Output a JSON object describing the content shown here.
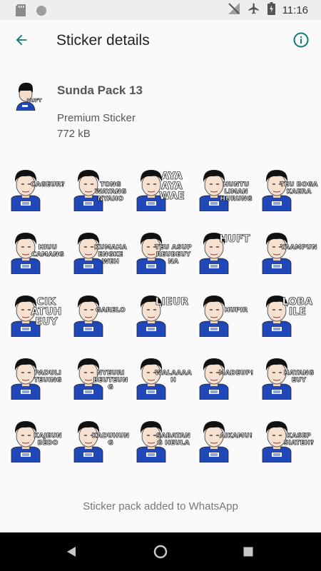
{
  "status_bar": {
    "time": "11:16",
    "icons": [
      "sd-card-icon",
      "circle-icon",
      "no-signal-icon",
      "airplane-icon",
      "battery-charging-icon"
    ]
  },
  "app_bar": {
    "title": "Sticker details",
    "back_icon": "arrow-left-icon",
    "info_icon": "info-circle-icon",
    "accent_color": "#0f7a73"
  },
  "pack": {
    "name": "Sunda Pack 13",
    "publisher": "Premium Sticker",
    "size": "772 kB",
    "icon_caption": "HUFT"
  },
  "stickers": [
    {
      "label": "CAGEUR?",
      "big": false
    },
    {
      "label": "TONG WAYANG NYAHO",
      "big": false
    },
    {
      "label": "AYA AYA WAE",
      "big": true
    },
    {
      "label": "HUNTU LIMAN HURUNG",
      "big": false
    },
    {
      "label": "TEU BOGA KAERA",
      "big": false
    },
    {
      "label": "HIUU CAMANG",
      "big": false
    },
    {
      "label": "KUMAHA ENGKE WEH",
      "big": false
    },
    {
      "label": "TEU ASUP REUBEUYNA",
      "big": false
    },
    {
      "label": "HUFT",
      "big": true
    },
    {
      "label": "YAAMPUN",
      "big": false
    },
    {
      "label": "CIK ATUH EUY",
      "big": true
    },
    {
      "label": "GARELO",
      "big": false
    },
    {
      "label": "LIEUR",
      "big": true
    },
    {
      "label": "HUPIR",
      "big": false
    },
    {
      "label": "LOBA ILE",
      "big": true
    },
    {
      "label": "PADULI TEUING",
      "big": false
    },
    {
      "label": "NYEURI BEUTEUNG",
      "big": false
    },
    {
      "label": "WALAAAAH",
      "big": false
    },
    {
      "label": "MADEUP!",
      "big": false
    },
    {
      "label": "HAYANG EUY",
      "big": false
    },
    {
      "label": "KAJEUN BEDO",
      "big": false
    },
    {
      "label": "KADUHUNG",
      "big": false
    },
    {
      "label": "SABATANG HEULA",
      "big": false
    },
    {
      "label": "AIKAMU!",
      "big": false
    },
    {
      "label": "KASEP SIATEH?",
      "big": false
    }
  ],
  "footer": {
    "status_text": "Sticker pack added to WhatsApp"
  },
  "nav_bar": {
    "back_icon": "nav-back-triangle-icon",
    "home_icon": "nav-home-circle-icon",
    "recents_icon": "nav-recents-square-icon"
  }
}
